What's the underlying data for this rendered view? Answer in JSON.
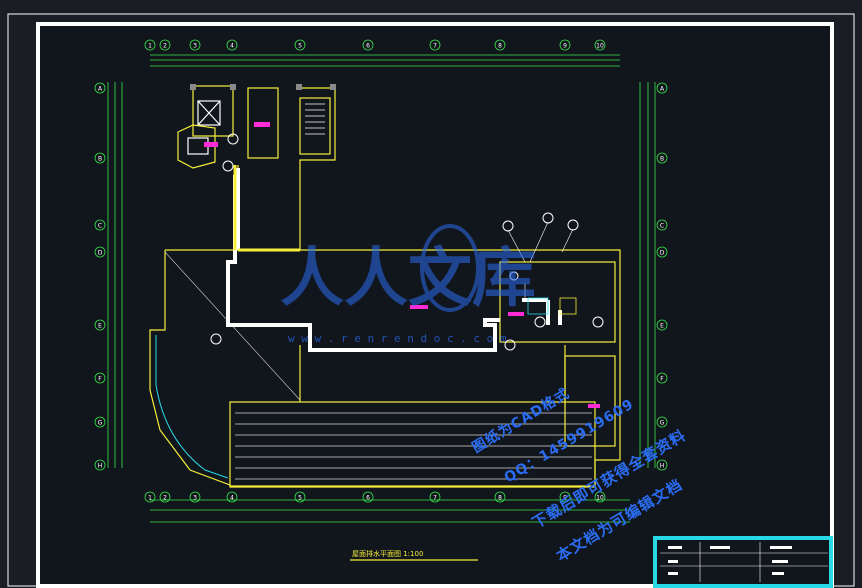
{
  "colors": {
    "background": "#1b1d24",
    "paper": "#11151c",
    "frame": "#ffffff",
    "cyan": "#27d9e6",
    "green": "#39e64a",
    "yellow": "#f5ef3a",
    "magenta": "#ff2bd6",
    "wall": "#ffffff",
    "watermark_blue": "#2b6df2"
  },
  "watermark": {
    "logo_text": "人人文库",
    "url": "w w w . r e n r e n d o c . c o m"
  },
  "promo_lines": [
    "图纸为CAD格式",
    "QQ：1459919609",
    "下载后即可获得全套资料",
    "本文档为可编辑文档"
  ],
  "drawing": {
    "title": "屋面排水平面图 1:100",
    "axis_labels_top": [
      "1",
      "2",
      "3",
      "4",
      "5",
      "6",
      "7",
      "8",
      "9",
      "10"
    ],
    "axis_labels_left": [
      "A",
      "B",
      "C",
      "D",
      "E",
      "F",
      "G",
      "H"
    ]
  },
  "title_block": {
    "rows": [
      "",
      "",
      ""
    ]
  }
}
